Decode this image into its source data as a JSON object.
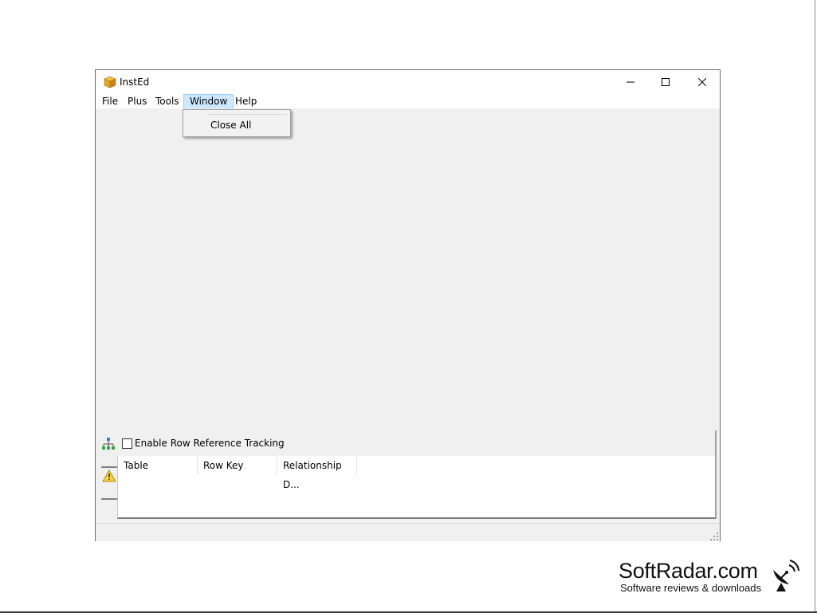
{
  "window": {
    "title": "InstEd",
    "controls": [
      "minimize",
      "maximize",
      "close"
    ]
  },
  "menu": {
    "items": [
      "File",
      "Plus",
      "Tools",
      "Window",
      "Help"
    ],
    "active": "Window"
  },
  "window_menu": {
    "items": [
      "Close All"
    ]
  },
  "bottom_panel": {
    "checkbox_label": "Enable Row Reference Tracking",
    "checkbox_checked": false,
    "columns": [
      "Table",
      "Row Key",
      "Relationship D..."
    ]
  },
  "watermark": {
    "title": "SoftRadar.com",
    "subtitle": "Software reviews & downloads"
  },
  "icons": {
    "app": "package-icon",
    "tracking": "tree-network-icon",
    "warning": "warning-icon",
    "watermark": "satellite-dish-icon"
  }
}
